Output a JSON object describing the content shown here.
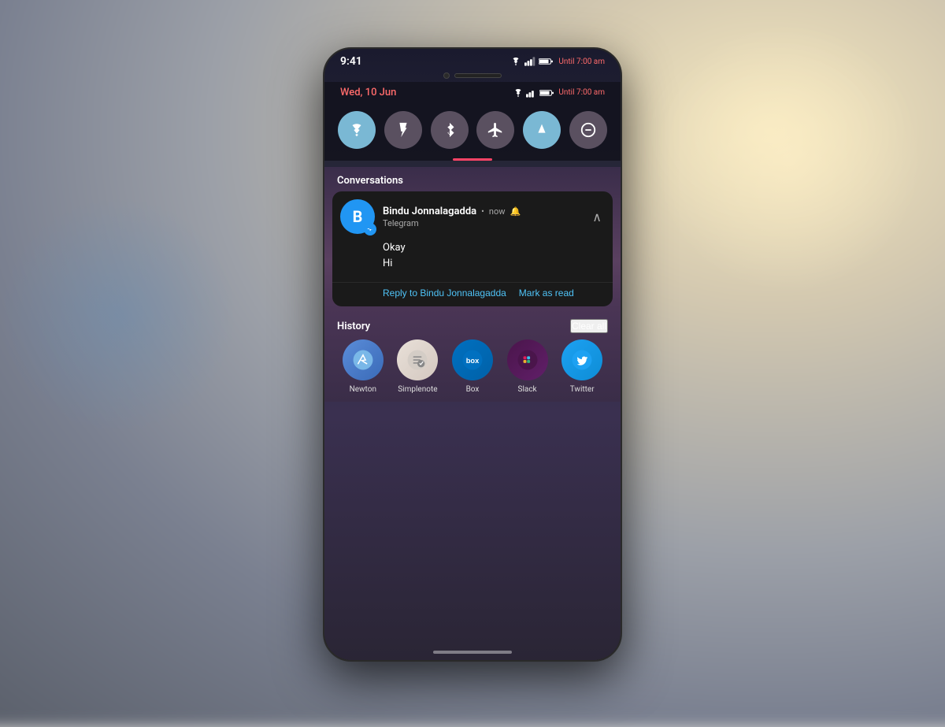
{
  "background": {
    "color": "#b0b8c0"
  },
  "phone": {
    "status_bar": {
      "time": "9:41",
      "date": "Wed, 10 Jun",
      "until_text": "Until 7:00 am"
    },
    "quick_settings": {
      "tiles": [
        {
          "id": "wifi",
          "label": "Wi-Fi",
          "active": true
        },
        {
          "id": "flashlight",
          "label": "Flashlight",
          "active": false
        },
        {
          "id": "bluetooth",
          "label": "Bluetooth",
          "active": false
        },
        {
          "id": "airplane",
          "label": "Airplane mode",
          "active": false
        },
        {
          "id": "data",
          "label": "Mobile data",
          "active": true
        },
        {
          "id": "dnd",
          "label": "Do not disturb",
          "active": false
        }
      ]
    },
    "conversations": {
      "section_label": "Conversations",
      "notification": {
        "sender": "Bindu Jonnalagadda",
        "time": "now",
        "app": "Telegram",
        "messages": [
          "Okay",
          "Hi"
        ],
        "action_reply": "Reply to Bindu Jonnalagadda",
        "action_mark_read": "Mark as read"
      }
    },
    "history": {
      "section_label": "History",
      "clear_label": "Clear all",
      "apps": [
        {
          "id": "newton",
          "label": "Newton"
        },
        {
          "id": "simplenote",
          "label": "Simplenote"
        },
        {
          "id": "box",
          "label": "Box"
        },
        {
          "id": "slack",
          "label": "Slack"
        },
        {
          "id": "twitter",
          "label": "Twitter"
        }
      ]
    }
  }
}
